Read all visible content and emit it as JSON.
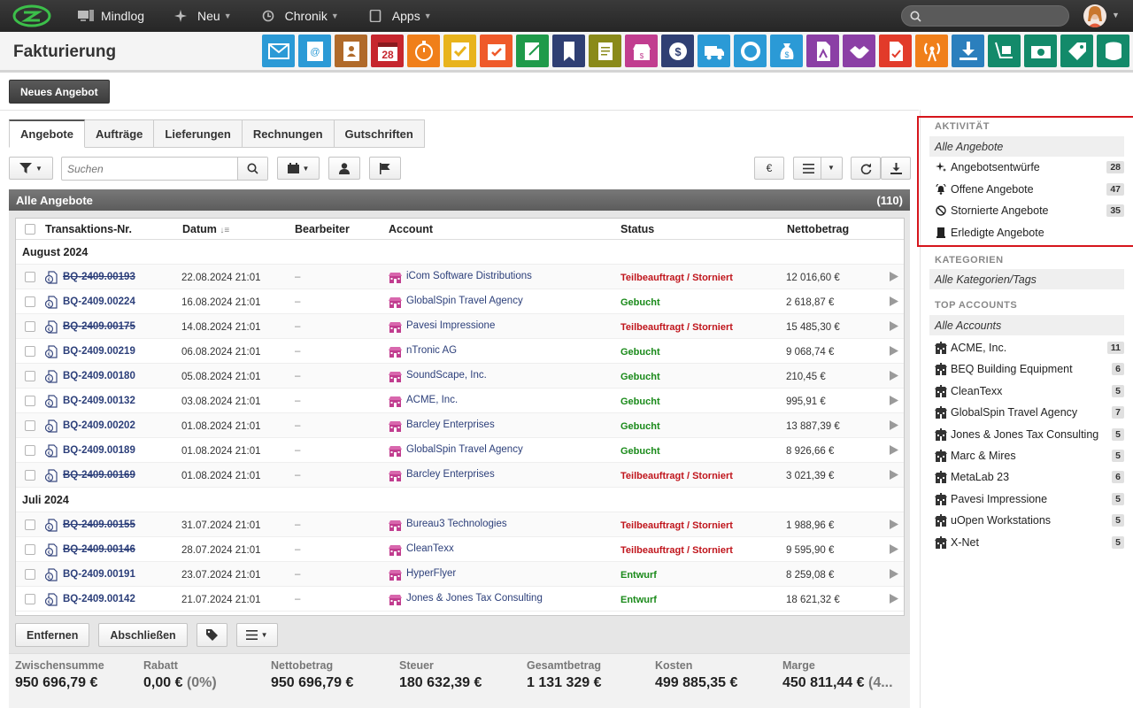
{
  "topnav": {
    "items": [
      {
        "label": "Mindlog",
        "icon": "monitor-icon",
        "caret": false
      },
      {
        "label": "Neu",
        "icon": "sparkle-icon",
        "caret": true
      },
      {
        "label": "Chronik",
        "icon": "history-icon",
        "caret": true
      },
      {
        "label": "Apps",
        "icon": "tablet-icon",
        "caret": true
      }
    ]
  },
  "page": {
    "title": "Fakturierung"
  },
  "apps": [
    {
      "name": "mail-app-icon",
      "color": "#2b9ad6"
    },
    {
      "name": "address-book-app-icon",
      "color": "#2b9ad6"
    },
    {
      "name": "contacts-app-icon",
      "color": "#b06a2a"
    },
    {
      "name": "calendar-app-icon",
      "color": "#c6262e"
    },
    {
      "name": "timer-app-icon",
      "color": "#f07f1a"
    },
    {
      "name": "tasks-app-icon",
      "color": "#e8b31c"
    },
    {
      "name": "projects-app-icon",
      "color": "#ef5a2a"
    },
    {
      "name": "notes-app-icon",
      "color": "#1f9a4a"
    },
    {
      "name": "bookmark-app-icon",
      "color": "#2f3f73"
    },
    {
      "name": "documents-app-icon",
      "color": "#8a8a1a"
    },
    {
      "name": "shop-app-icon",
      "color": "#c13d8f"
    },
    {
      "name": "billing-app-icon",
      "color": "#2f3f73"
    },
    {
      "name": "delivery-app-icon",
      "color": "#2b9ad6"
    },
    {
      "name": "support-app-icon",
      "color": "#2b9ad6"
    },
    {
      "name": "finance-app-icon",
      "color": "#2b9ad6"
    },
    {
      "name": "contracts-app-icon",
      "color": "#8b3fa5"
    },
    {
      "name": "deals-app-icon",
      "color": "#8b3fa5"
    },
    {
      "name": "pdf-app-icon",
      "color": "#e23b2a"
    },
    {
      "name": "broadcast-app-icon",
      "color": "#f07f1a"
    },
    {
      "name": "download-app-icon",
      "color": "#2b7fbd"
    },
    {
      "name": "inventory-app-icon",
      "color": "#138a6a"
    },
    {
      "name": "cashbook-app-icon",
      "color": "#138a6a"
    },
    {
      "name": "price-tag-app-icon",
      "color": "#138a6a"
    },
    {
      "name": "database-app-icon",
      "color": "#138a6a"
    }
  ],
  "actions": {
    "new_offer": "Neues Angebot"
  },
  "tabs": [
    "Angebote",
    "Aufträge",
    "Lieferungen",
    "Rechnungen",
    "Gutschriften"
  ],
  "toolbar": {
    "search_placeholder": "Suchen",
    "currency": "€"
  },
  "list": {
    "title": "Alle Angebote",
    "count": "(110)",
    "columns": [
      "Transaktions-Nr.",
      "Datum",
      "Bearbeiter",
      "Account",
      "Status",
      "Nettobetrag"
    ],
    "groups": [
      {
        "label": "August 2024",
        "rows": [
          {
            "nr": "BQ-2409.00193",
            "strike": true,
            "date": "22.08.2024 21:01",
            "editor": "–",
            "account": "iCom Software Distributions",
            "status": "Teilbeauftragt / Storniert",
            "status_type": "red",
            "amount": "12 016,60 €"
          },
          {
            "nr": "BQ-2409.00224",
            "strike": false,
            "date": "16.08.2024 21:01",
            "editor": "–",
            "account": "GlobalSpin Travel Agency",
            "status": "Gebucht",
            "status_type": "green",
            "amount": "2 618,87 €"
          },
          {
            "nr": "BQ-2409.00175",
            "strike": true,
            "date": "14.08.2024 21:01",
            "editor": "–",
            "account": "Pavesi Impressione",
            "status": "Teilbeauftragt / Storniert",
            "status_type": "red",
            "amount": "15 485,30 €"
          },
          {
            "nr": "BQ-2409.00219",
            "strike": false,
            "date": "06.08.2024 21:01",
            "editor": "–",
            "account": "nTronic AG",
            "status": "Gebucht",
            "status_type": "green",
            "amount": "9 068,74 €"
          },
          {
            "nr": "BQ-2409.00180",
            "strike": false,
            "date": "05.08.2024 21:01",
            "editor": "–",
            "account": "SoundScape, Inc.",
            "status": "Gebucht",
            "status_type": "green",
            "amount": "210,45 €"
          },
          {
            "nr": "BQ-2409.00132",
            "strike": false,
            "date": "03.08.2024 21:01",
            "editor": "–",
            "account": "ACME, Inc.",
            "status": "Gebucht",
            "status_type": "green",
            "amount": "995,91 €"
          },
          {
            "nr": "BQ-2409.00202",
            "strike": false,
            "date": "01.08.2024 21:01",
            "editor": "–",
            "account": "Barcley Enterprises",
            "status": "Gebucht",
            "status_type": "green",
            "amount": "13 887,39 €"
          },
          {
            "nr": "BQ-2409.00189",
            "strike": false,
            "date": "01.08.2024 21:01",
            "editor": "–",
            "account": "GlobalSpin Travel Agency",
            "status": "Gebucht",
            "status_type": "green",
            "amount": "8 926,66 €"
          },
          {
            "nr": "BQ-2409.00169",
            "strike": true,
            "date": "01.08.2024 21:01",
            "editor": "–",
            "account": "Barcley Enterprises",
            "status": "Teilbeauftragt / Storniert",
            "status_type": "red",
            "amount": "3 021,39 €"
          }
        ]
      },
      {
        "label": "Juli 2024",
        "rows": [
          {
            "nr": "BQ-2409.00155",
            "strike": true,
            "date": "31.07.2024 21:01",
            "editor": "–",
            "account": "Bureau3 Technologies",
            "status": "Teilbeauftragt / Storniert",
            "status_type": "red",
            "amount": "1 988,96 €"
          },
          {
            "nr": "BQ-2409.00146",
            "strike": true,
            "date": "28.07.2024 21:01",
            "editor": "–",
            "account": "CleanTexx",
            "status": "Teilbeauftragt / Storniert",
            "status_type": "red",
            "amount": "9 595,90 €"
          },
          {
            "nr": "BQ-2409.00191",
            "strike": false,
            "date": "23.07.2024 21:01",
            "editor": "–",
            "account": "HyperFlyer",
            "status": "Entwurf",
            "status_type": "green",
            "amount": "8 259,08 €"
          },
          {
            "nr": "BQ-2409.00142",
            "strike": false,
            "date": "21.07.2024 21:01",
            "editor": "–",
            "account": "Jones & Jones Tax Consulting",
            "status": "Entwurf",
            "status_type": "green",
            "amount": "18 621,32 €"
          }
        ]
      }
    ]
  },
  "bottom": {
    "remove": "Entfernen",
    "complete": "Abschließen"
  },
  "totals": [
    {
      "label": "Zwischensumme",
      "value": "950 696,79 €",
      "extra": ""
    },
    {
      "label": "Rabatt",
      "value": "0,00 €",
      "extra": "(0%)"
    },
    {
      "label": "Nettobetrag",
      "value": "950 696,79 €",
      "extra": ""
    },
    {
      "label": "Steuer",
      "value": "180 632,39 €",
      "extra": ""
    },
    {
      "label": "Gesamtbetrag",
      "value": "1 131 329 €",
      "extra": ""
    },
    {
      "label": "Kosten",
      "value": "499 885,35 €",
      "extra": ""
    },
    {
      "label": "Marge",
      "value": "450 811,44 €",
      "extra": "(4..."
    }
  ],
  "sidebar": {
    "activity_title": "AKTIVITÄT",
    "activity_all": "Alle Angebote",
    "activity": [
      {
        "label": "Angebotsentwürfe",
        "count": "28",
        "icon": "sparkle-icon"
      },
      {
        "label": "Offene Angebote",
        "count": "47",
        "icon": "bell-icon"
      },
      {
        "label": "Stornierte Angebote",
        "count": "35",
        "icon": "cancel-icon"
      },
      {
        "label": "Erledigte Angebote",
        "count": "",
        "icon": "archive-icon"
      }
    ],
    "categories_title": "KATEGORIEN",
    "categories_all": "Alle Kategorien/Tags",
    "accounts_title": "TOP ACCOUNTS",
    "accounts_all": "Alle Accounts",
    "accounts": [
      {
        "label": "ACME, Inc.",
        "count": "11"
      },
      {
        "label": "BEQ Building Equipment",
        "count": "6"
      },
      {
        "label": "CleanTexx",
        "count": "5"
      },
      {
        "label": "GlobalSpin Travel Agency",
        "count": "7"
      },
      {
        "label": "Jones & Jones Tax Consulting",
        "count": "5"
      },
      {
        "label": "Marc & Mires",
        "count": "5"
      },
      {
        "label": "MetaLab 23",
        "count": "6"
      },
      {
        "label": "Pavesi Impressione",
        "count": "5"
      },
      {
        "label": "uOpen Workstations",
        "count": "5"
      },
      {
        "label": "X-Net",
        "count": "5"
      }
    ]
  }
}
